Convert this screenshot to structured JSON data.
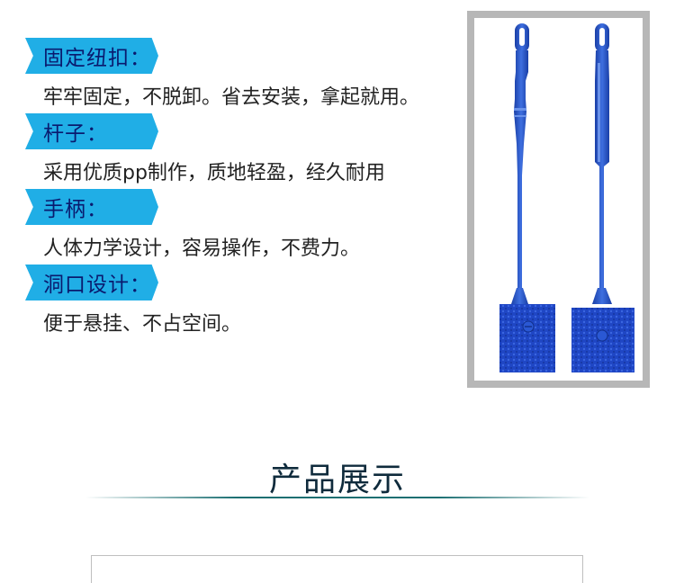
{
  "features": [
    {
      "tag": "固定纽扣：",
      "desc": "牢牢固定，不脱卸。省去安装，拿起就用。"
    },
    {
      "tag": "杆子：",
      "desc": "采用优质pp制作，质地轻盈，经久耐用"
    },
    {
      "tag": "手柄：",
      "desc": "人体力学设计，容易操作，不费力。"
    },
    {
      "tag": "洞口设计：",
      "desc": "便于悬挂、不占空间。"
    }
  ],
  "section": {
    "title": "产品展示"
  },
  "colors": {
    "tag_bg": "#20aee6",
    "tag_text": "#0a1a6e",
    "brush_blue": "#2450c8",
    "rule": "#1b6f72"
  }
}
